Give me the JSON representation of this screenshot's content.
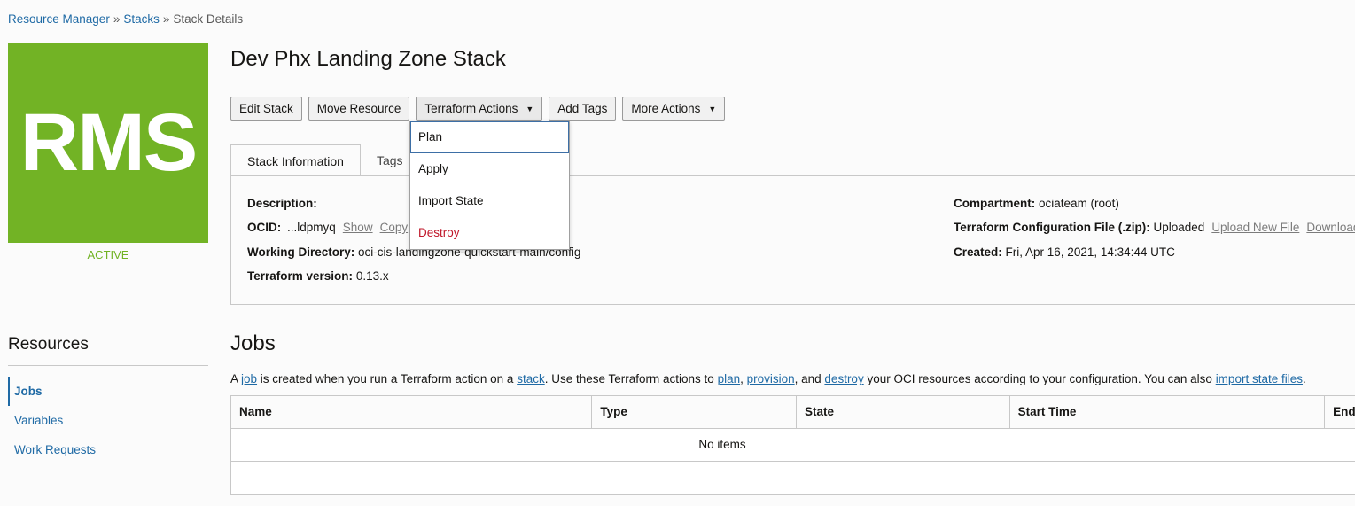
{
  "breadcrumb": {
    "items": [
      "Resource Manager",
      "Stacks",
      "Stack Details"
    ],
    "separator": "»"
  },
  "logo": {
    "text": "RMS",
    "color": "#72b325"
  },
  "status": "ACTIVE",
  "title": "Dev Phx Landing Zone Stack",
  "actions": {
    "edit_stack": "Edit Stack",
    "move_resource": "Move Resource",
    "terraform_actions": "Terraform Actions",
    "add_tags": "Add Tags",
    "more_actions": "More Actions"
  },
  "terraform_menu": {
    "plan": "Plan",
    "apply": "Apply",
    "import_state": "Import State",
    "destroy": "Destroy"
  },
  "tabs": {
    "stack_information": "Stack Information",
    "tags": "Tags"
  },
  "stack_info": {
    "description_label": "Description:",
    "description_value": "",
    "ocid_label": "OCID:",
    "ocid_value": "...ldpmyq",
    "ocid_show": "Show",
    "ocid_copy": "Copy",
    "working_dir_label": "Working Directory:",
    "working_dir_value": "oci-cis-landingzone-quickstart-main/config",
    "tf_version_label": "Terraform version:",
    "tf_version_value": "0.13.x",
    "compartment_label": "Compartment:",
    "compartment_value": "ociateam (root)",
    "tf_config_label": "Terraform Configuration File (.zip):",
    "tf_config_value": "Uploaded",
    "upload_new_file": "Upload New File",
    "download": "Download",
    "created_label": "Created:",
    "created_value": "Fri, Apr 16, 2021, 14:34:44 UTC"
  },
  "resources": {
    "title": "Resources",
    "items": [
      {
        "label": "Jobs",
        "active": true
      },
      {
        "label": "Variables",
        "active": false
      },
      {
        "label": "Work Requests",
        "active": false
      }
    ]
  },
  "jobs": {
    "title": "Jobs",
    "desc": {
      "p1": "A ",
      "job": "job",
      "p2": " is created when you run a Terraform action on a ",
      "stack": "stack",
      "p3": ". Use these Terraform actions to ",
      "plan": "plan",
      "c1": ", ",
      "provision": "provision",
      "p4": ", and ",
      "destroy": "destroy",
      "p5": " your OCI resources according to your configuration. You can also ",
      "import_state_files": "import state files",
      "p6": "."
    },
    "columns": [
      "Name",
      "Type",
      "State",
      "Start Time",
      "End"
    ],
    "empty_message": "No items"
  }
}
